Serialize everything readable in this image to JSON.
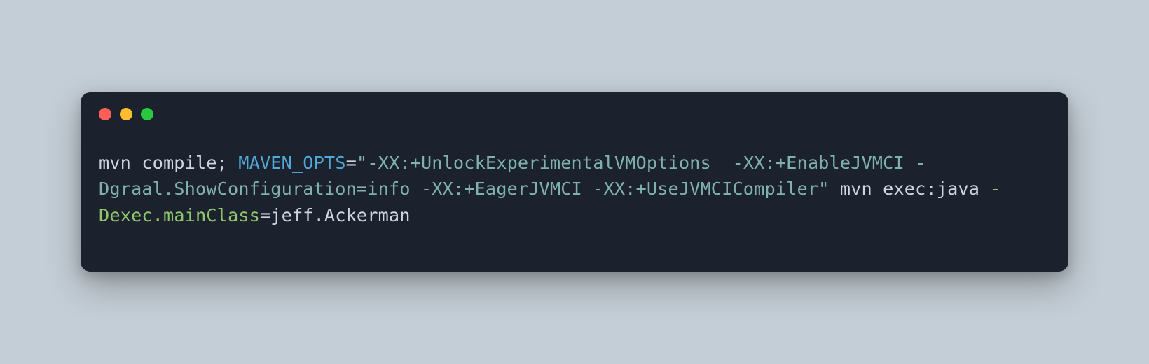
{
  "window": {
    "traffic_lights": {
      "close": "close",
      "minimize": "minimize",
      "zoom": "zoom"
    }
  },
  "colors": {
    "background": "#c4ced6",
    "terminal_bg": "#1b212d",
    "text_default": "#cfd6e1",
    "var": "#4fa8d8",
    "string": "#7fb1af",
    "flag": "#8fc66b",
    "tl_close": "#ff5f57",
    "tl_min": "#febc2e",
    "tl_zoom": "#28c840"
  },
  "code": {
    "tokens": [
      {
        "text": "mvn compile; ",
        "cls": "tok-default"
      },
      {
        "text": "MAVEN_OPTS",
        "cls": "tok-var"
      },
      {
        "text": "=",
        "cls": "tok-default"
      },
      {
        "text": "\"-XX:+UnlockExperimentalVMOptions  -XX:+EnableJVMCI -Dgraal.ShowConfiguration=info -XX:+EagerJVMCI -XX:+UseJVMCICompiler\"",
        "cls": "tok-string"
      },
      {
        "text": " mvn exec:java ",
        "cls": "tok-default"
      },
      {
        "text": "-Dexec.mainClass",
        "cls": "tok-flag"
      },
      {
        "text": "=jeff.Ackerman",
        "cls": "tok-default"
      }
    ]
  }
}
